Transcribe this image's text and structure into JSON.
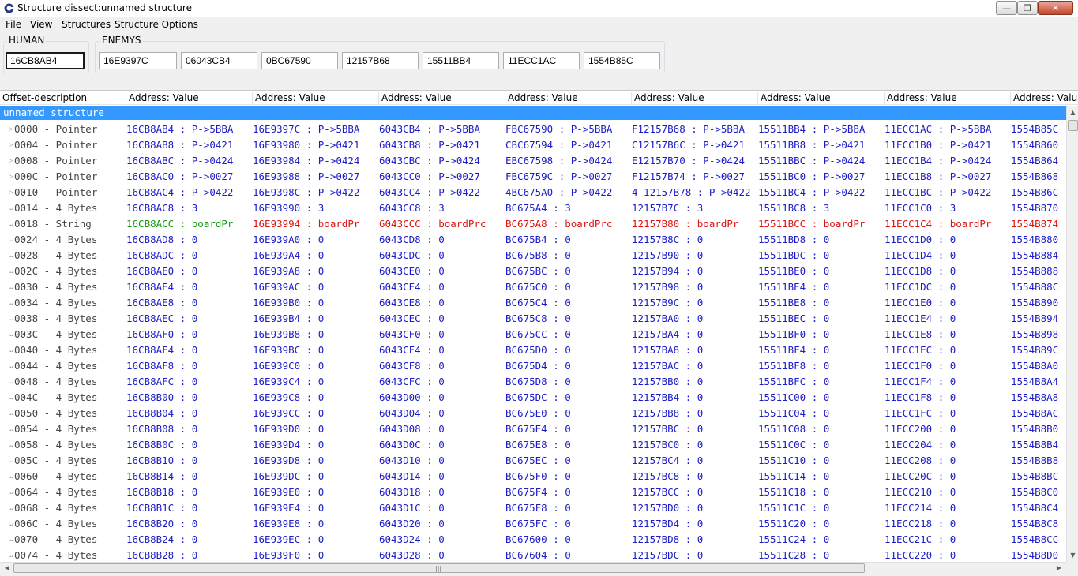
{
  "window": {
    "title": "Structure dissect:unnamed structure"
  },
  "menu": [
    "File",
    "View",
    "Structures",
    "Structure Options"
  ],
  "groups": {
    "human": {
      "label": "HUMAN",
      "addresses": [
        "16CB8AB4"
      ]
    },
    "enemies": {
      "label": "ENEMYS",
      "addresses": [
        "16E9397C",
        "06043CB4",
        "0BC67590",
        "12157B68",
        "15511BB4",
        "11ECC1AC",
        "1554B85C"
      ]
    }
  },
  "columns": [
    "Offset-description",
    "Address: Value",
    "Address: Value",
    "Address: Value",
    "Address: Value",
    "Address: Value",
    "Address: Value",
    "Address: Value",
    "Address: Value"
  ],
  "tree": {
    "section_label": "unnamed structure",
    "rows": [
      {
        "desc": "0000 - Pointer",
        "expandable": true,
        "cells": [
          "16CB8AB4 : P->5BBA",
          "16E9397C : P->5BBA",
          "6043CB4 : P->5BBA",
          "FBC67590 : P->5BBA",
          "F12157B68 : P->5BBA",
          "15511BB4 : P->5BBA",
          "11ECC1AC : P->5BBA",
          "1554B85C"
        ]
      },
      {
        "desc": "0004 - Pointer",
        "expandable": true,
        "cells": [
          "16CB8AB8 : P->0421",
          "16E93980 : P->0421",
          "6043CB8 : P->0421",
          "CBC67594 : P->0421",
          "C12157B6C : P->0421",
          "15511BB8 : P->0421",
          "11ECC1B0 : P->0421",
          "1554B860"
        ]
      },
      {
        "desc": "0008 - Pointer",
        "expandable": true,
        "cells": [
          "16CB8ABC : P->0424",
          "16E93984 : P->0424",
          "6043CBC : P->0424",
          "EBC67598 : P->0424",
          "E12157B70 : P->0424",
          "15511BBC : P->0424",
          "11ECC1B4 : P->0424",
          "1554B864"
        ]
      },
      {
        "desc": "000C - Pointer",
        "expandable": true,
        "cells": [
          "16CB8AC0 : P->0027",
          "16E93988 : P->0027",
          "6043CC0 : P->0027",
          "FBC6759C : P->0027",
          "F12157B74 : P->0027",
          "15511BC0 : P->0027",
          "11ECC1B8 : P->0027",
          "1554B868"
        ]
      },
      {
        "desc": "0010 - Pointer",
        "expandable": true,
        "cells": [
          "16CB8AC4 : P->0422",
          "16E9398C : P->0422",
          "6043CC4 : P->0422",
          "4BC675A0 : P->0422",
          "4 12157B78 : P->0422",
          "15511BC4 : P->0422",
          "11ECC1BC : P->0422",
          "1554B86C"
        ]
      },
      {
        "desc": "0014 - 4 Bytes",
        "expandable": false,
        "cells": [
          "16CB8AC8 : 3",
          "16E93990 : 3",
          "6043CC8 : 3",
          "BC675A4 : 3",
          "12157B7C : 3",
          "15511BC8 : 3",
          "11ECC1C0 : 3",
          "1554B870"
        ]
      },
      {
        "desc": "0018 - String",
        "expandable": false,
        "style": "string",
        "cells": [
          "16CB8ACC : boardPr",
          "16E93994 : boardPr",
          "6043CCC : boardPrc",
          "BC675A8 : boardPrc",
          "12157B80 : boardPr",
          "15511BCC : boardPr",
          "11ECC1C4 : boardPr",
          "1554B874"
        ]
      },
      {
        "desc": "0024 - 4 Bytes",
        "expandable": false,
        "cells": [
          "16CB8AD8 : 0",
          "16E939A0 : 0",
          "6043CD8 : 0",
          "BC675B4 : 0",
          "12157B8C : 0",
          "15511BD8 : 0",
          "11ECC1D0 : 0",
          "1554B880"
        ]
      },
      {
        "desc": "0028 - 4 Bytes",
        "expandable": false,
        "cells": [
          "16CB8ADC : 0",
          "16E939A4 : 0",
          "6043CDC : 0",
          "BC675B8 : 0",
          "12157B90 : 0",
          "15511BDC : 0",
          "11ECC1D4 : 0",
          "1554B884"
        ]
      },
      {
        "desc": "002C - 4 Bytes",
        "expandable": false,
        "cells": [
          "16CB8AE0 : 0",
          "16E939A8 : 0",
          "6043CE0 : 0",
          "BC675BC : 0",
          "12157B94 : 0",
          "15511BE0 : 0",
          "11ECC1D8 : 0",
          "1554B888"
        ]
      },
      {
        "desc": "0030 - 4 Bytes",
        "expandable": false,
        "cells": [
          "16CB8AE4 : 0",
          "16E939AC : 0",
          "6043CE4 : 0",
          "BC675C0 : 0",
          "12157B98 : 0",
          "15511BE4 : 0",
          "11ECC1DC : 0",
          "1554B88C"
        ]
      },
      {
        "desc": "0034 - 4 Bytes",
        "expandable": false,
        "cells": [
          "16CB8AE8 : 0",
          "16E939B0 : 0",
          "6043CE8 : 0",
          "BC675C4 : 0",
          "12157B9C : 0",
          "15511BE8 : 0",
          "11ECC1E0 : 0",
          "1554B890"
        ]
      },
      {
        "desc": "0038 - 4 Bytes",
        "expandable": false,
        "cells": [
          "16CB8AEC : 0",
          "16E939B4 : 0",
          "6043CEC : 0",
          "BC675C8 : 0",
          "12157BA0 : 0",
          "15511BEC : 0",
          "11ECC1E4 : 0",
          "1554B894"
        ]
      },
      {
        "desc": "003C - 4 Bytes",
        "expandable": false,
        "cells": [
          "16CB8AF0 : 0",
          "16E939B8 : 0",
          "6043CF0 : 0",
          "BC675CC : 0",
          "12157BA4 : 0",
          "15511BF0 : 0",
          "11ECC1E8 : 0",
          "1554B898"
        ]
      },
      {
        "desc": "0040 - 4 Bytes",
        "expandable": false,
        "cells": [
          "16CB8AF4 : 0",
          "16E939BC : 0",
          "6043CF4 : 0",
          "BC675D0 : 0",
          "12157BA8 : 0",
          "15511BF4 : 0",
          "11ECC1EC : 0",
          "1554B89C"
        ]
      },
      {
        "desc": "0044 - 4 Bytes",
        "expandable": false,
        "cells": [
          "16CB8AF8 : 0",
          "16E939C0 : 0",
          "6043CF8 : 0",
          "BC675D4 : 0",
          "12157BAC : 0",
          "15511BF8 : 0",
          "11ECC1F0 : 0",
          "1554B8A0"
        ]
      },
      {
        "desc": "0048 - 4 Bytes",
        "expandable": false,
        "cells": [
          "16CB8AFC : 0",
          "16E939C4 : 0",
          "6043CFC : 0",
          "BC675D8 : 0",
          "12157BB0 : 0",
          "15511BFC : 0",
          "11ECC1F4 : 0",
          "1554B8A4"
        ]
      },
      {
        "desc": "004C - 4 Bytes",
        "expandable": false,
        "cells": [
          "16CB8B00 : 0",
          "16E939C8 : 0",
          "6043D00 : 0",
          "BC675DC : 0",
          "12157BB4 : 0",
          "15511C00 : 0",
          "11ECC1F8 : 0",
          "1554B8A8"
        ]
      },
      {
        "desc": "0050 - 4 Bytes",
        "expandable": false,
        "cells": [
          "16CB8B04 : 0",
          "16E939CC : 0",
          "6043D04 : 0",
          "BC675E0 : 0",
          "12157BB8 : 0",
          "15511C04 : 0",
          "11ECC1FC : 0",
          "1554B8AC"
        ]
      },
      {
        "desc": "0054 - 4 Bytes",
        "expandable": false,
        "cells": [
          "16CB8B08 : 0",
          "16E939D0 : 0",
          "6043D08 : 0",
          "BC675E4 : 0",
          "12157BBC : 0",
          "15511C08 : 0",
          "11ECC200 : 0",
          "1554B8B0"
        ]
      },
      {
        "desc": "0058 - 4 Bytes",
        "expandable": false,
        "cells": [
          "16CB8B0C : 0",
          "16E939D4 : 0",
          "6043D0C : 0",
          "BC675E8 : 0",
          "12157BC0 : 0",
          "15511C0C : 0",
          "11ECC204 : 0",
          "1554B8B4"
        ]
      },
      {
        "desc": "005C - 4 Bytes",
        "expandable": false,
        "cells": [
          "16CB8B10 : 0",
          "16E939D8 : 0",
          "6043D10 : 0",
          "BC675EC : 0",
          "12157BC4 : 0",
          "15511C10 : 0",
          "11ECC208 : 0",
          "1554B8B8"
        ]
      },
      {
        "desc": "0060 - 4 Bytes",
        "expandable": false,
        "cells": [
          "16CB8B14 : 0",
          "16E939DC : 0",
          "6043D14 : 0",
          "BC675F0 : 0",
          "12157BC8 : 0",
          "15511C14 : 0",
          "11ECC20C : 0",
          "1554B8BC"
        ]
      },
      {
        "desc": "0064 - 4 Bytes",
        "expandable": false,
        "cells": [
          "16CB8B18 : 0",
          "16E939E0 : 0",
          "6043D18 : 0",
          "BC675F4 : 0",
          "12157BCC : 0",
          "15511C18 : 0",
          "11ECC210 : 0",
          "1554B8C0"
        ]
      },
      {
        "desc": "0068 - 4 Bytes",
        "expandable": false,
        "cells": [
          "16CB8B1C : 0",
          "16E939E4 : 0",
          "6043D1C : 0",
          "BC675F8 : 0",
          "12157BD0 : 0",
          "15511C1C : 0",
          "11ECC214 : 0",
          "1554B8C4"
        ]
      },
      {
        "desc": "006C - 4 Bytes",
        "expandable": false,
        "cells": [
          "16CB8B20 : 0",
          "16E939E8 : 0",
          "6043D20 : 0",
          "BC675FC : 0",
          "12157BD4 : 0",
          "15511C20 : 0",
          "11ECC218 : 0",
          "1554B8C8"
        ]
      },
      {
        "desc": "0070 - 4 Bytes",
        "expandable": false,
        "cells": [
          "16CB8B24 : 0",
          "16E939EC : 0",
          "6043D24 : 0",
          "BC67600 : 0",
          "12157BD8 : 0",
          "15511C24 : 0",
          "11ECC21C : 0",
          "1554B8CC"
        ]
      },
      {
        "desc": "0074 - 4 Bytes",
        "expandable": false,
        "cells": [
          "16CB8B28 : 0",
          "16E939F0 : 0",
          "6043D28 : 0",
          "BC67604 : 0",
          "12157BDC : 0",
          "15511C28 : 0",
          "11ECC220 : 0",
          "1554B8D0"
        ]
      }
    ]
  },
  "colors": {
    "selection": "#3399ff",
    "value": "#1c1cc8",
    "string_first": "#0f9a0f",
    "string_other": "#dd1111"
  }
}
